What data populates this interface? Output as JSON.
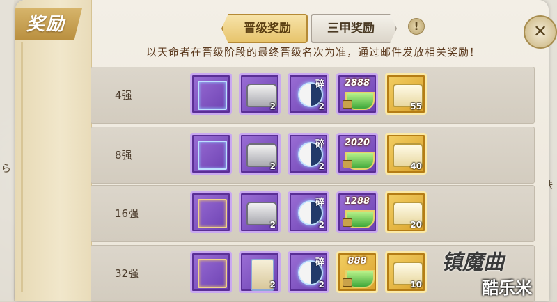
{
  "panel": {
    "title": "奖励",
    "tabs": [
      {
        "label": "晋级奖励",
        "active": true
      },
      {
        "label": "三甲奖励",
        "active": false
      }
    ],
    "info_icon": "!",
    "close_icon": "close-icon",
    "notice": "以天命者在晋级阶段的最终晋级名次为准，通过邮件发放相关奖励！"
  },
  "rows": [
    {
      "label": "4强",
      "items": [
        {
          "icon": "frame-icon",
          "color": "purple",
          "count": ""
        },
        {
          "icon": "chest-icon",
          "color": "purple",
          "count": "2"
        },
        {
          "icon": "yinyang-fragment-icon",
          "color": "purple",
          "count": "2",
          "tag": "碎"
        },
        {
          "icon": "ingot-icon",
          "color": "purple",
          "count": "",
          "amount": "2888"
        },
        {
          "icon": "gold-chest-icon",
          "color": "gold",
          "count": "55"
        }
      ]
    },
    {
      "label": "8强",
      "items": [
        {
          "icon": "frame-icon",
          "color": "purple",
          "count": ""
        },
        {
          "icon": "chest-icon",
          "color": "purple",
          "count": "2"
        },
        {
          "icon": "yinyang-fragment-icon",
          "color": "purple",
          "count": "2",
          "tag": "碎"
        },
        {
          "icon": "ingot-icon",
          "color": "purple",
          "count": "",
          "amount": "2020"
        },
        {
          "icon": "gold-chest-icon",
          "color": "gold",
          "count": "40"
        }
      ]
    },
    {
      "label": "16强",
      "items": [
        {
          "icon": "gold-frame-icon",
          "color": "purple",
          "count": ""
        },
        {
          "icon": "chest-icon",
          "color": "purple",
          "count": "2"
        },
        {
          "icon": "yinyang-fragment-icon",
          "color": "purple",
          "count": "2",
          "tag": "碎"
        },
        {
          "icon": "ingot-icon",
          "color": "purple",
          "count": "",
          "amount": "1288"
        },
        {
          "icon": "gold-chest-icon",
          "color": "gold",
          "count": "20"
        }
      ]
    },
    {
      "label": "32强",
      "items": [
        {
          "icon": "gold-frame-icon",
          "color": "purple",
          "count": ""
        },
        {
          "icon": "scroll-icon",
          "color": "purple",
          "count": "2"
        },
        {
          "icon": "fragment-icon",
          "color": "purple",
          "count": "2",
          "tag": "碎"
        },
        {
          "icon": "ingot-icon",
          "color": "gold",
          "count": "",
          "amount": "888"
        },
        {
          "icon": "gold-chest-icon",
          "color": "gold",
          "count": "10"
        }
      ]
    }
  ],
  "watermark": {
    "logo": "镇魔曲",
    "site": "酷乐米"
  },
  "edge_text": {
    "left": "ら",
    "right": "肤"
  },
  "colors": {
    "tab_active": "#e7c46c",
    "item_purple": "#7a4cc2",
    "item_gold": "#e2ac35",
    "notice_text": "#5c3a1e"
  }
}
